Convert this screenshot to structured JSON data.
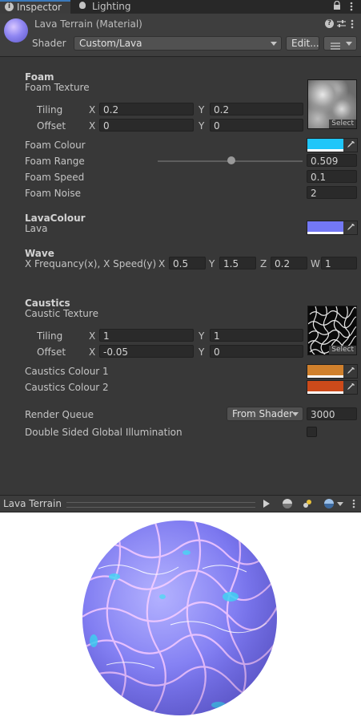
{
  "tabs": [
    {
      "label": "Inspector",
      "icon": "info-icon"
    },
    {
      "label": "Lighting",
      "icon": "bulb-icon"
    }
  ],
  "material": {
    "title": "Lava Terrain (Material)",
    "shader_label": "Shader",
    "shader_value": "Custom/Lava",
    "edit_label": "Edit..."
  },
  "foam": {
    "header": "Foam",
    "texture_label": "Foam Texture",
    "tiling_label": "Tiling",
    "offset_label": "Offset",
    "tiling_x": "0.2",
    "tiling_y": "0.2",
    "offset_x": "0",
    "offset_y": "0",
    "select_label": "Select",
    "colour_label": "Foam Colour",
    "colour_hex": "#1fc6f9",
    "range_label": "Foam Range",
    "range_value": "0.509",
    "range_fraction": 0.509,
    "speed_label": "Foam Speed",
    "speed_value": "0.1",
    "noise_label": "Foam Noise",
    "noise_value": "2"
  },
  "lava": {
    "header": "LavaColour",
    "label": "Lava",
    "colour_hex": "#7378f5"
  },
  "wave": {
    "header": "Wave",
    "label": "X Frequancy(x), X Speed(y), Z",
    "x": "0.5",
    "y": "1.5",
    "z": "0.2",
    "w": "1"
  },
  "caustics": {
    "header": "Caustics",
    "texture_label": "Caustic Texture",
    "tiling_label": "Tiling",
    "offset_label": "Offset",
    "tiling_x": "1",
    "tiling_y": "1",
    "offset_x": "-0.05",
    "offset_y": "0",
    "select_label": "Select",
    "colour1_label": "Caustics Colour 1",
    "colour1_hex": "#d0802c",
    "colour2_label": "Caustics Colour 2",
    "colour2_hex": "#cc4a1a"
  },
  "render": {
    "queue_label": "Render Queue",
    "queue_mode": "From Shader",
    "queue_value": "3000",
    "gi_label": "Double Sided Global Illumination",
    "gi_checked": false
  },
  "preview": {
    "title": "Lava Terrain"
  },
  "axes": {
    "x": "X",
    "y": "Y",
    "z": "Z",
    "w": "W"
  }
}
